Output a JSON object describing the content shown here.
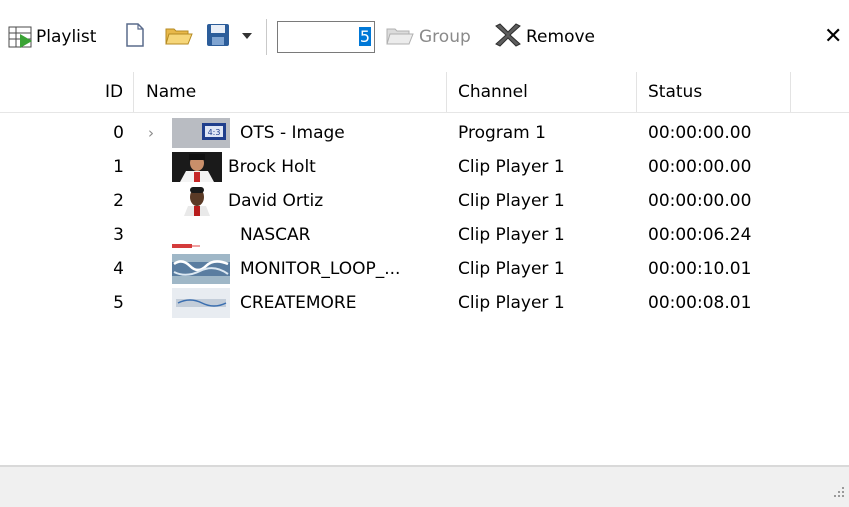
{
  "toolbar": {
    "playlist_label": "Playlist",
    "number_value": "5",
    "group_label": "Group",
    "remove_label": "Remove",
    "close_glyph": "✕"
  },
  "columns": {
    "id": "ID",
    "name": "Name",
    "channel": "Channel",
    "status": "Status"
  },
  "rows": [
    {
      "id": "0",
      "name": "OTS - Image",
      "channel": "Program 1",
      "status": "00:00:00.00",
      "expander": "›"
    },
    {
      "id": "1",
      "name": "Brock Holt",
      "channel": "Clip Player 1",
      "status": "00:00:00.00"
    },
    {
      "id": "2",
      "name": "David Ortiz",
      "channel": "Clip Player 1",
      "status": "00:00:00.00"
    },
    {
      "id": "3",
      "name": "NASCAR",
      "channel": "Clip Player 1",
      "status": "00:00:06.24"
    },
    {
      "id": "4",
      "name": "MONITOR_LOOP_...",
      "channel": "Clip Player 1",
      "status": "00:00:10.01"
    },
    {
      "id": "5",
      "name": "CREATEMORE",
      "channel": "Clip Player 1",
      "status": "00:00:08.01"
    }
  ],
  "icons": {
    "playlist": "playlist-icon",
    "new": "new-file-icon",
    "open": "open-folder-icon",
    "save": "save-icon",
    "dropdown": "chevron-down-icon",
    "group": "group-icon",
    "remove": "remove-icon",
    "close": "close-icon"
  },
  "colors": {
    "selection": "#0078d7",
    "disabled_text": "#8a8a8a",
    "statusbar": "#f0f0f0"
  }
}
